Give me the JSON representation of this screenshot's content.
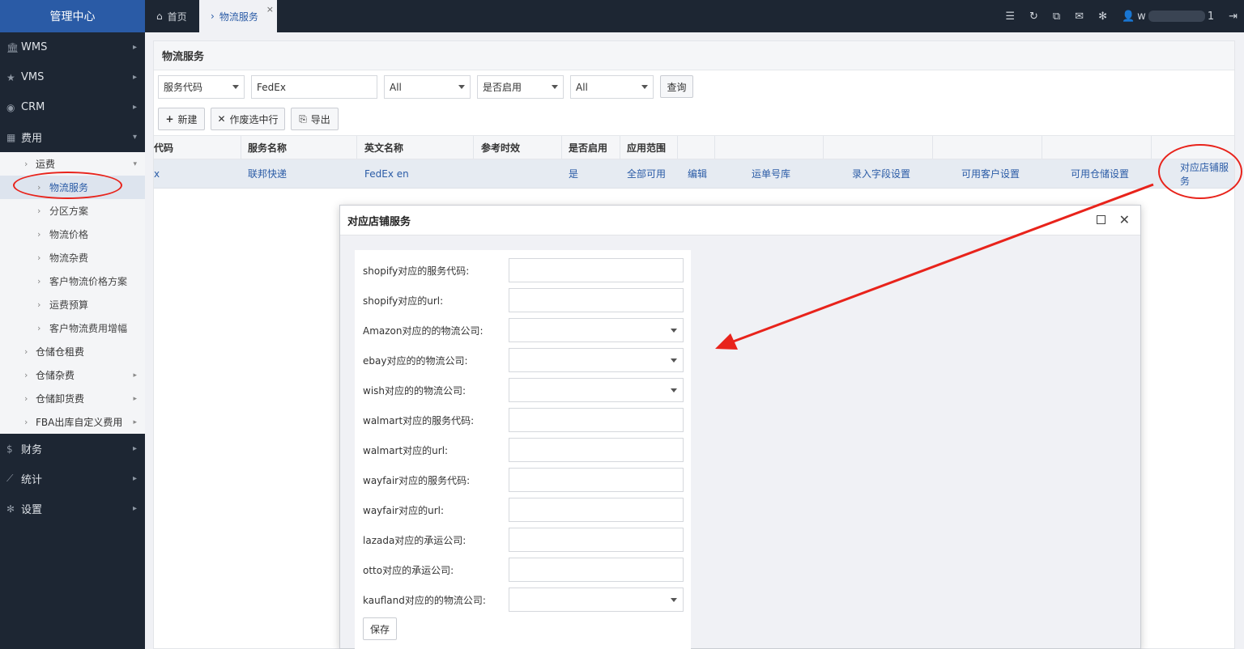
{
  "brand": "管理中心",
  "sidebar": {
    "top_items": [
      {
        "icon": "bank-icon",
        "glyph": "🏛",
        "label": "WMS"
      },
      {
        "icon": "star-icon",
        "glyph": "★",
        "label": "VMS"
      },
      {
        "icon": "user-circle-icon",
        "glyph": "◉",
        "label": "CRM"
      },
      {
        "icon": "grid-icon",
        "glyph": "▦",
        "label": "费用"
      }
    ],
    "fee_sub": {
      "freight": "运费",
      "freight_items": [
        "物流服务",
        "分区方案",
        "物流价格",
        "物流杂费",
        "客户物流价格方案",
        "运费预算",
        "客户物流费用增幅"
      ],
      "others": [
        "仓储仓租费",
        "仓储杂费",
        "仓储卸货费",
        "FBA出库自定义费用"
      ]
    },
    "bottom_items": [
      {
        "icon": "dollar-icon",
        "glyph": "$",
        "label": "财务"
      },
      {
        "icon": "chart-icon",
        "glyph": "⟋",
        "label": "统计"
      },
      {
        "icon": "gear-icon",
        "glyph": "✻",
        "label": "设置"
      }
    ]
  },
  "topbar": {
    "home_tab": "首页",
    "active_tab": "物流服务",
    "user_prefix": "w",
    "user_suffix": "1"
  },
  "panel": {
    "title": "物流服务",
    "filters": {
      "field_select": "服务代码",
      "keyword": "FedEx",
      "all1": "All",
      "enabled_select": "是否启用",
      "all2": "All",
      "query": "查询"
    },
    "actions": {
      "new": "新建",
      "void": "作废选中行",
      "export": "导出"
    },
    "columns": [
      "代码",
      "服务名称",
      "英文名称",
      "参考时效",
      "是否启用",
      "应用范围"
    ],
    "row": {
      "code": "x",
      "name": "联邦快递",
      "en_name": "FedEx en",
      "eta": "",
      "enabled": "是",
      "scope": "全部可用",
      "links": [
        "编辑",
        "运单号库",
        "录入字段设置",
        "可用客户设置",
        "可用仓储设置",
        "对应店铺服务"
      ]
    }
  },
  "modal": {
    "title": "对应店铺服务",
    "fields": [
      {
        "label": "shopify对应的服务代码:",
        "type": "text"
      },
      {
        "label": "shopify对应的url:",
        "type": "text"
      },
      {
        "label": "Amazon对应的的物流公司:",
        "type": "select"
      },
      {
        "label": "ebay对应的的物流公司:",
        "type": "select"
      },
      {
        "label": "wish对应的的物流公司:",
        "type": "select"
      },
      {
        "label": "walmart对应的服务代码:",
        "type": "text"
      },
      {
        "label": "walmart对应的url:",
        "type": "text"
      },
      {
        "label": "wayfair对应的服务代码:",
        "type": "text"
      },
      {
        "label": "wayfair对应的url:",
        "type": "text"
      },
      {
        "label": "lazada对应的承运公司:",
        "type": "text"
      },
      {
        "label": "otto对应的承运公司:",
        "type": "text"
      },
      {
        "label": "kaufland对应的的物流公司:",
        "type": "select"
      }
    ],
    "save": "保存"
  },
  "colors": {
    "sidebar": "#1d2633",
    "brand": "#2a5ba6",
    "annotation": "#e8231b"
  }
}
